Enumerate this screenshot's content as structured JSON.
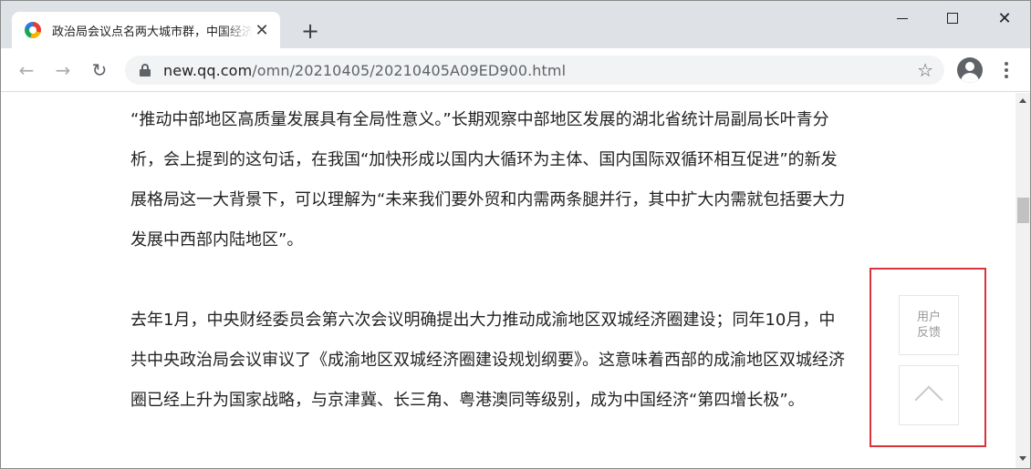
{
  "browser": {
    "tab": {
      "title": "政治局会议点名两大城市群，中国经济“第四增长极”",
      "favicon": "qq-news-icon",
      "close_label": "✕"
    },
    "new_tab_label": "+",
    "window_controls": {
      "close_label": "✕"
    },
    "toolbar": {
      "back_label": "←",
      "forward_label": "→",
      "reload_label": "↻",
      "url_host": "new.qq.com",
      "url_path": "/omn/20210405/20210405A09ED900.html",
      "bookmark_label": "☆"
    }
  },
  "article": {
    "paragraphs": [
      "“推动中部地区高质量发展具有全局性意义。”长期观察中部地区发展的湖北省统计局副局长叶青分析，会上提到的这句话，在我国“加快形成以国内大循环为主体、国内国际双循环相互促进”的新发展格局这一大背景下，可以理解为“未来我们要外贸和内需两条腿并行，其中扩大内需就包括要大力发展中西部内陆地区”。",
      "去年1月，中央财经委员会第六次会议明确提出大力推动成渝地区双城经济圈建设；同年10月，中共中央政治局会议审议了《成渝地区双城经济圈建设规划纲要》。这意味着西部的成渝地区双城经济圈已经上升为国家战略，与京津冀、长三角、粤港澳同等级别，成为中国经济“第四增长极”。"
    ]
  },
  "float_panel": {
    "feedback_line1": "用户",
    "feedback_line2": "反馈",
    "highlight_color": "#d9343a"
  }
}
